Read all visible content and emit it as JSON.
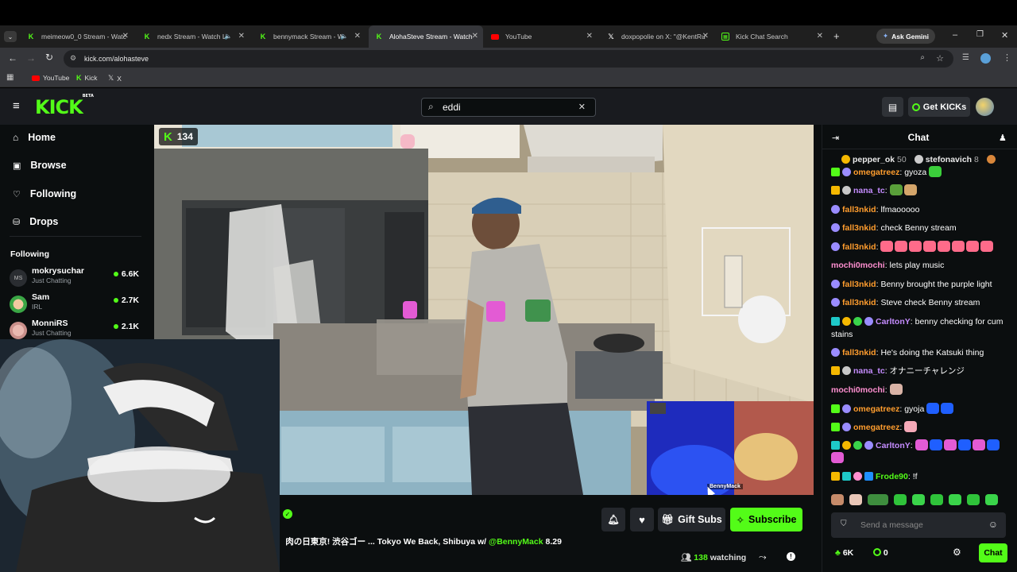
{
  "browser": {
    "tabs": [
      {
        "label": "meimeow0_0 Stream - Watc",
        "icon": "kick-favicon",
        "color": "#53fc18"
      },
      {
        "label": "nedx Stream - Watch Li",
        "icon": "kick-favicon",
        "color": "#53fc18"
      },
      {
        "label": "bennymack Stream - W",
        "icon": "kick-favicon",
        "color": "#53fc18"
      },
      {
        "label": "AlohaSteve Stream - Watch",
        "icon": "kick-favicon",
        "color": "#53fc18"
      },
      {
        "label": "YouTube",
        "icon": "youtube-favicon",
        "color": "#ff0000"
      },
      {
        "label": "doxpopolie on X: \"@KentRu",
        "icon": "x-favicon",
        "color": "#ffffff"
      },
      {
        "label": "Kick Chat Search",
        "icon": "kick-chat-search-favicon",
        "color": "#53fc18"
      }
    ],
    "ask_gemini": "Ask Gemini",
    "url": "kick.com/alohasteve",
    "bookmarks": [
      {
        "label": "YouTube",
        "icon": "youtube-favicon"
      },
      {
        "label": "Kick",
        "icon": "kick-favicon"
      },
      {
        "label": "X",
        "icon": "x-favicon"
      }
    ]
  },
  "kick": {
    "logo": "KICK",
    "logo_beta": "BETA",
    "search_value": "eddi",
    "get_kicks": "Get KICKs",
    "nav": [
      {
        "label": "Home",
        "icon": "home-icon"
      },
      {
        "label": "Browse",
        "icon": "browse-icon"
      },
      {
        "label": "Following",
        "icon": "heart-icon"
      },
      {
        "label": "Drops",
        "icon": "drops-icon"
      }
    ],
    "following_title": "Following",
    "following": [
      {
        "name": "mokrysuchar",
        "category": "Just Chatting",
        "viewers": "6.6K",
        "avatar_text": "MS"
      },
      {
        "name": "Sam",
        "category": "IRL",
        "viewers": "2.7K",
        "avatar_text": ""
      },
      {
        "name": "MonniRS",
        "category": "Just Chatting",
        "viewers": "2.1K",
        "avatar_text": ""
      }
    ],
    "video": {
      "viewer_badge": "134",
      "pip_label": "BennyMack"
    },
    "stream": {
      "title_prefix": "肉の日東京! 渋谷ゴー ... Tokyo We Back, Shibuya w/ ",
      "title_mention": "@BennyMack",
      "title_suffix": " 8.29",
      "watching_count": "138",
      "watching_label": "watching",
      "gift_subs": "Gift Subs",
      "subscribe": "Subscribe"
    },
    "chat": {
      "title": "Chat",
      "pinned": [
        {
          "name": "pepper_ok",
          "count": "50"
        },
        {
          "name": "stefonavich",
          "count": "8"
        }
      ],
      "messages": [
        {
          "user": "omegatreez",
          "color": "orange",
          "text": "gyoza",
          "badges": [
            "kick",
            "sub"
          ],
          "emotes": [
            "#3bcf3b"
          ]
        },
        {
          "user": "nana_tc",
          "color": "purple",
          "text": "",
          "badges": [
            "crown",
            "user"
          ],
          "emotes": [
            "#5aa03a",
            "#d4a56a"
          ]
        },
        {
          "user": "fall3nkid",
          "color": "orange",
          "text": "lfmaooooo",
          "badges": [
            "sub"
          ],
          "emotes": []
        },
        {
          "user": "fall3nkid",
          "color": "orange",
          "text": "check Benny stream",
          "badges": [
            "sub"
          ],
          "emotes": []
        },
        {
          "user": "fall3nkid",
          "color": "orange",
          "text": "",
          "badges": [
            "sub"
          ],
          "emotes": [
            "#ff6b8a",
            "#ff6b8a",
            "#ff6b8a",
            "#ff6b8a",
            "#ff6b8a",
            "#ff6b8a",
            "#ff6b8a",
            "#ff6b8a"
          ]
        },
        {
          "user": "mochi0mochi",
          "color": "pink",
          "text": "lets play music",
          "badges": [],
          "emotes": []
        },
        {
          "user": "fall3nkid",
          "color": "orange",
          "text": "Benny brought the purple light",
          "badges": [
            "sub"
          ],
          "emotes": []
        },
        {
          "user": "fall3nkid",
          "color": "orange",
          "text": "Steve check Benny stream",
          "badges": [
            "sub"
          ],
          "emotes": []
        },
        {
          "user": "CarltonY",
          "color": "purple",
          "text": "benny checking for cum stains",
          "badges": [
            "gift",
            "coin",
            "green",
            "sub"
          ],
          "emotes": []
        },
        {
          "user": "fall3nkid",
          "color": "orange",
          "text": "He's doing the Katsuki thing",
          "badges": [
            "sub"
          ],
          "emotes": []
        },
        {
          "user": "nana_tc",
          "color": "purple",
          "text": "オナニーチャレンジ",
          "badges": [
            "crown",
            "user"
          ],
          "emotes": []
        },
        {
          "user": "mochi0mochi",
          "color": "pink",
          "text": "",
          "badges": [],
          "emotes": [
            "#d9b3a6"
          ]
        },
        {
          "user": "omegatreez",
          "color": "orange",
          "text": "gyoja",
          "badges": [
            "kick",
            "sub"
          ],
          "emotes": [
            "#1f5fff",
            "#1f5fff"
          ]
        },
        {
          "user": "omegatreez",
          "color": "orange",
          "text": "",
          "badges": [
            "kick",
            "sub"
          ],
          "emotes": [
            "#f5a9b8"
          ]
        },
        {
          "user": "CarltonY",
          "color": "purple",
          "text": "",
          "badges": [
            "gift",
            "coin",
            "green",
            "sub"
          ],
          "emotes": [
            "#e35bd4",
            "#1f5fff",
            "#e35bd4",
            "#1f5fff",
            "#e35bd4",
            "#1f5fff",
            "#e35bd4"
          ]
        },
        {
          "user": "Frode90",
          "color": "green",
          "text": "!f",
          "badges": [
            "crown",
            "gift",
            "gift2",
            "x"
          ],
          "emotes": []
        }
      ],
      "input_placeholder": "Send a message",
      "kicks_count": "6K",
      "points_count": "0",
      "send_label": "Chat"
    }
  }
}
